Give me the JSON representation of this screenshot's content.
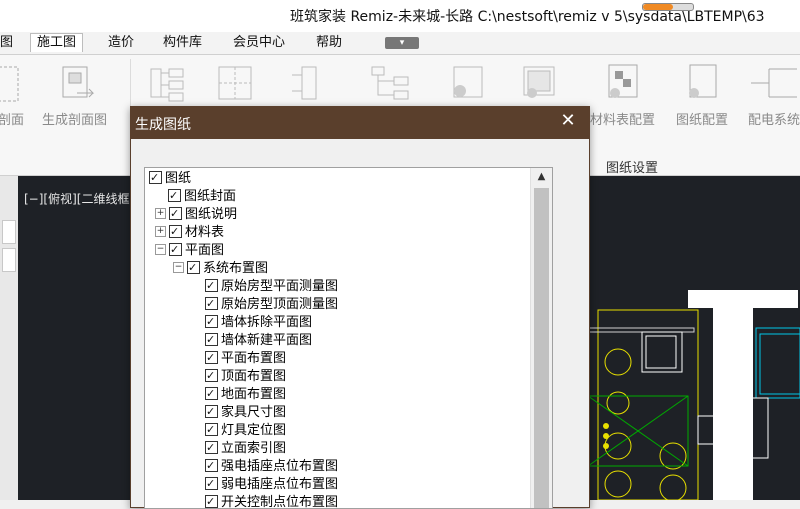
{
  "titlebar": {
    "title": "班筑家装 Remiz-未来城-长路    C:\\nestsoft\\remiz v 5\\sysdata\\LBTEMP\\63",
    "progress": 0.6
  },
  "menu": {
    "items": [
      "图",
      "施工图",
      "造价",
      "构件库",
      "会员中心",
      "帮助"
    ],
    "active": "施工图"
  },
  "ribbon": {
    "buttons": [
      "剖面",
      "生成剖面图",
      "",
      "",
      "",
      "",
      "",
      "材料表配置",
      "图纸配置",
      "配电系统"
    ],
    "group_label": "图纸设置"
  },
  "viewport": {
    "label": "[−][俯视][二维线框"
  },
  "dialog": {
    "title": "生成图纸",
    "close_icon": "close-icon",
    "tree": [
      {
        "label": "图纸",
        "level": 0,
        "expander": ""
      },
      {
        "label": "图纸封面",
        "level": 1,
        "expander": ""
      },
      {
        "label": "图纸说明",
        "level": 1,
        "expander": "+"
      },
      {
        "label": "材料表",
        "level": 1,
        "expander": "+"
      },
      {
        "label": "平面图",
        "level": 1,
        "expander": "−"
      },
      {
        "label": "系统布置图",
        "level": 2,
        "expander": "−"
      },
      {
        "label": "原始房型平面测量图",
        "level": 3,
        "expander": ""
      },
      {
        "label": "原始房型顶面测量图",
        "level": 3,
        "expander": ""
      },
      {
        "label": "墙体拆除平面图",
        "level": 3,
        "expander": ""
      },
      {
        "label": "墙体新建平面图",
        "level": 3,
        "expander": ""
      },
      {
        "label": "平面布置图",
        "level": 3,
        "expander": ""
      },
      {
        "label": "顶面布置图",
        "level": 3,
        "expander": ""
      },
      {
        "label": "地面布置图",
        "level": 3,
        "expander": ""
      },
      {
        "label": "家具尺寸图",
        "level": 3,
        "expander": ""
      },
      {
        "label": "灯具定位图",
        "level": 3,
        "expander": ""
      },
      {
        "label": "立面索引图",
        "level": 3,
        "expander": ""
      },
      {
        "label": "强电插座点位布置图",
        "level": 3,
        "expander": ""
      },
      {
        "label": "弱电插座点位布置图",
        "level": 3,
        "expander": ""
      },
      {
        "label": "开关控制点位布置图",
        "level": 3,
        "expander": ""
      }
    ]
  },
  "colors": {
    "dialog_title_bg": "#5a3f2c",
    "viewport_bg": "#1e2126",
    "cad_yellow": "#e8e000",
    "cad_cyan": "#00c8e8"
  }
}
